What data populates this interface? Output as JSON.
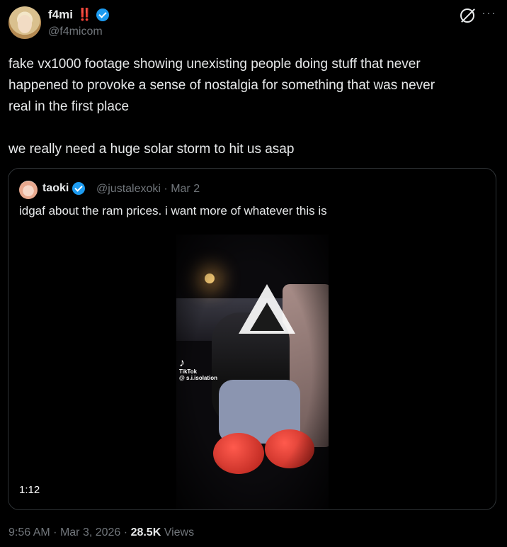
{
  "author": {
    "name": "f4mi",
    "emoji": "‼️",
    "handle": "@f4micom"
  },
  "tweet": {
    "text": "fake vx1000 footage showing unexisting people doing stuff that never\nhappened to provoke a sense of nostalgia for something that was never\nreal in the first place\n\nwe really need a huge solar storm to hit us asap"
  },
  "quote": {
    "name": "taoki",
    "handle": "@justalexoki",
    "date_sep": "·",
    "date": "Mar 2",
    "text": "idgaf about the ram prices. i want more of whatever this is",
    "video": {
      "watermark_brand": "TikTok",
      "watermark_user": "@ s.i.isolation",
      "duration": "1:12"
    }
  },
  "meta": {
    "time": "9:56 AM",
    "sep1": "·",
    "date": "Mar 3, 2026",
    "sep2": "·",
    "views_count": "28.5K",
    "views_label": "Views"
  },
  "icons": {
    "verified": "verified-badge-icon",
    "grok": "grok-icon",
    "more": "more-icon"
  },
  "colors": {
    "background": "#000000",
    "text": "#e7e9ea",
    "muted": "#71767b",
    "verified": "#1d9bf0",
    "border": "#2f3336"
  }
}
